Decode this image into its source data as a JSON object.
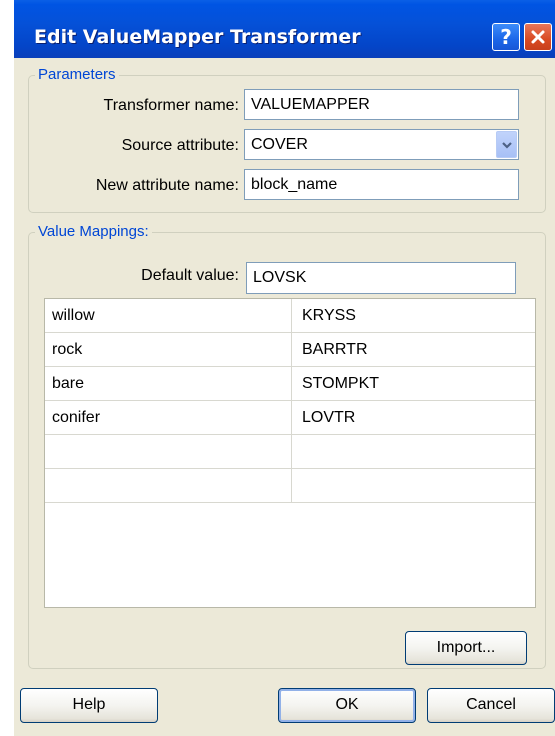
{
  "window": {
    "title": "Edit ValueMapper Transformer"
  },
  "title_buttons": {
    "help_glyph": "?",
    "close_icon": "close-x-icon"
  },
  "parameters": {
    "group_label": "Parameters",
    "transformer_name_label": "Transformer name:",
    "transformer_name_value": "VALUEMAPPER",
    "source_attribute_label": "Source attribute:",
    "source_attribute_value": "COVER",
    "new_attribute_name_label": "New attribute name:",
    "new_attribute_name_value": "block_name"
  },
  "value_mappings": {
    "group_label": "Value Mappings:",
    "default_value_label": "Default value:",
    "default_value": "LOVSK",
    "rows": [
      {
        "key": "willow",
        "value": "KRYSS"
      },
      {
        "key": "rock",
        "value": "BARRTR"
      },
      {
        "key": "bare",
        "value": "STOMPKT"
      },
      {
        "key": "conifer",
        "value": "LOVTR"
      },
      {
        "key": "",
        "value": ""
      },
      {
        "key": "",
        "value": ""
      }
    ],
    "import_label": "Import..."
  },
  "footer": {
    "help_label": "Help",
    "ok_label": "OK",
    "cancel_label": "Cancel"
  },
  "colors": {
    "title_bar": "#0054e3",
    "dialog_background": "#ece9d8",
    "group_label": "#0046d5",
    "close_button": "#d94a22"
  }
}
